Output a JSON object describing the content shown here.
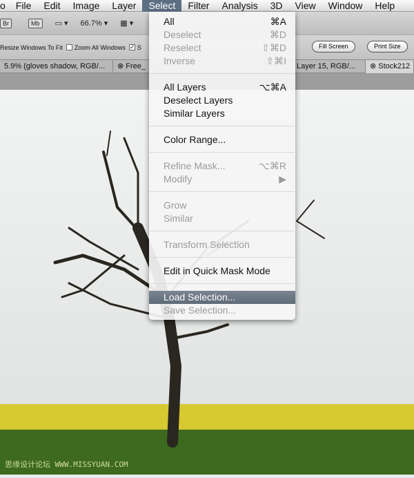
{
  "menubar": {
    "items": [
      "o",
      "File",
      "Edit",
      "Image",
      "Layer",
      "Select",
      "Filter",
      "Analysis",
      "3D",
      "View",
      "Window",
      "Help"
    ],
    "active": "Select"
  },
  "toolbar": {
    "br": "Br",
    "mb": "Mb",
    "zoom": "66.7%"
  },
  "options": {
    "resize": "Resize Windows To Fit",
    "zoom_all": "Zoom All Windows",
    "scrubby": "S",
    "fill_screen": "Fill Screen",
    "print_size": "Print Size"
  },
  "tabs": [
    "5.9% (gloves shadow, RGB/...",
    "Free_",
    "Layer 15, RGB/...",
    "Stock212"
  ],
  "menu": {
    "items": [
      {
        "label": "All",
        "shortcut": "⌘A",
        "enabled": true
      },
      {
        "label": "Deselect",
        "shortcut": "⌘D",
        "enabled": false
      },
      {
        "label": "Reselect",
        "shortcut": "⇧⌘D",
        "enabled": false
      },
      {
        "label": "Inverse",
        "shortcut": "⇧⌘I",
        "enabled": false
      },
      {
        "label": "All Layers",
        "shortcut": "⌥⌘A",
        "enabled": true
      },
      {
        "label": "Deselect Layers",
        "shortcut": "",
        "enabled": true
      },
      {
        "label": "Similar Layers",
        "shortcut": "",
        "enabled": true
      },
      {
        "label": "Color Range...",
        "shortcut": "",
        "enabled": true
      },
      {
        "label": "Refine Mask...",
        "shortcut": "⌥⌘R",
        "enabled": false
      },
      {
        "label": "Modify",
        "shortcut": "▶",
        "enabled": false
      },
      {
        "label": "Grow",
        "shortcut": "",
        "enabled": false
      },
      {
        "label": "Similar",
        "shortcut": "",
        "enabled": false
      },
      {
        "label": "Transform Selection",
        "shortcut": "",
        "enabled": false
      },
      {
        "label": "Edit in Quick Mask Mode",
        "shortcut": "",
        "enabled": true
      },
      {
        "label": "Load Selection...",
        "shortcut": "",
        "enabled": true,
        "highlighted": true
      },
      {
        "label": "Save Selection...",
        "shortcut": "",
        "enabled": false
      }
    ]
  },
  "watermark": "思缘设计论坛 WWW.MISSYUAN.COM",
  "colors": {
    "highlight": "#5f6b78",
    "grass": "#3d6a1e",
    "flowers": "#d8c832"
  }
}
